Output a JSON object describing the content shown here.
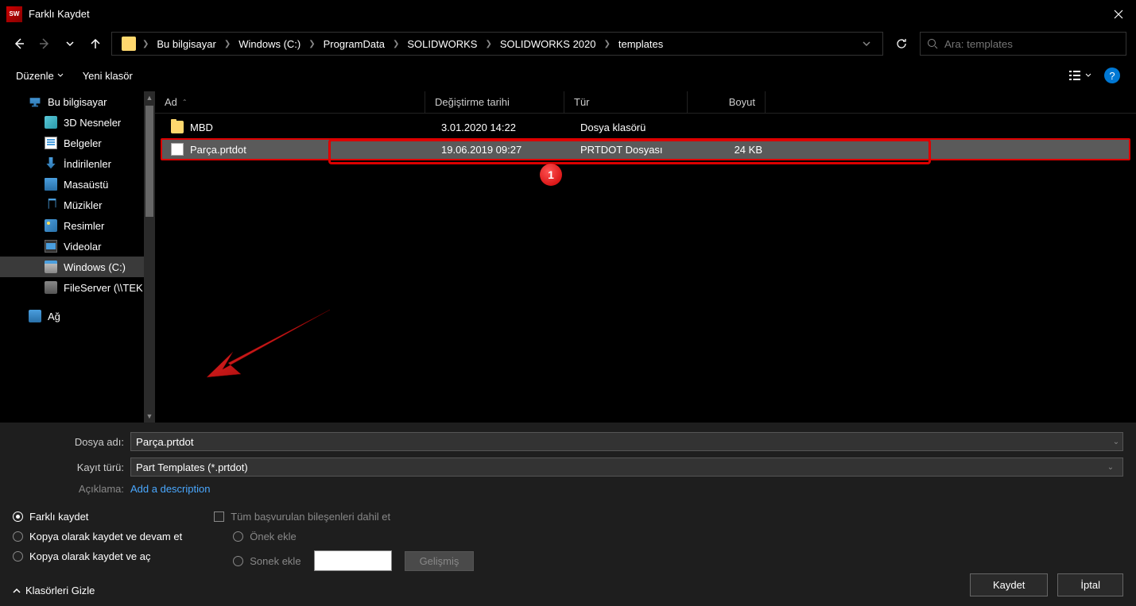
{
  "title": "Farklı Kaydet",
  "breadcrumb": [
    "Bu bilgisayar",
    "Windows (C:)",
    "ProgramData",
    "SOLIDWORKS",
    "SOLIDWORKS 2020",
    "templates"
  ],
  "search_placeholder": "Ara: templates",
  "toolbar": {
    "organize": "Düzenle",
    "new_folder": "Yeni klasör"
  },
  "sidebar": {
    "items": [
      {
        "label": "Bu bilgisayar",
        "icon": "ic-computer"
      },
      {
        "label": "3D Nesneler",
        "icon": "ic-3d",
        "l": 1
      },
      {
        "label": "Belgeler",
        "icon": "ic-docs",
        "l": 1
      },
      {
        "label": "İndirilenler",
        "icon": "ic-download",
        "l": 1
      },
      {
        "label": "Masaüstü",
        "icon": "ic-desktop",
        "l": 1
      },
      {
        "label": "Müzikler",
        "icon": "ic-music",
        "l": 1
      },
      {
        "label": "Resimler",
        "icon": "ic-pictures",
        "l": 1
      },
      {
        "label": "Videolar",
        "icon": "ic-videos",
        "l": 1
      },
      {
        "label": "Windows (C:)",
        "icon": "ic-disk",
        "l": 1,
        "selected": true
      },
      {
        "label": "FileServer (\\\\TEK",
        "icon": "ic-server",
        "l": 1
      }
    ],
    "network": "Ağ"
  },
  "headers": {
    "name": "Ad",
    "date": "Değiştirme tarihi",
    "type": "Tür",
    "size": "Boyut"
  },
  "files": [
    {
      "name": "MBD",
      "date": "3.01.2020 14:22",
      "type": "Dosya klasörü",
      "size": "",
      "icon": "ic-folder"
    },
    {
      "name": "Parça.prtdot",
      "date": "19.06.2019 09:27",
      "type": "PRTDOT Dosyası",
      "size": "24 KB",
      "icon": "ic-file",
      "selected": true
    }
  ],
  "annotation": {
    "badge": "1"
  },
  "form": {
    "filename_label": "Dosya adı:",
    "filename_value": "Parça.prtdot",
    "type_label": "Kayıt türü:",
    "type_value": "Part Templates (*.prtdot)",
    "desc_label": "Açıklama:",
    "desc_link": "Add a description"
  },
  "options": {
    "save_as": "Farklı kaydet",
    "save_copy_continue": "Kopya olarak kaydet ve devam et",
    "save_copy_open": "Kopya olarak kaydet ve aç",
    "include_refs": "Tüm başvurulan bileşenleri dahil et",
    "prefix": "Önek ekle",
    "suffix": "Sonek ekle",
    "advanced": "Gelişmiş",
    "hide_folders": "Klasörleri Gizle"
  },
  "buttons": {
    "save": "Kaydet",
    "cancel": "İptal"
  }
}
